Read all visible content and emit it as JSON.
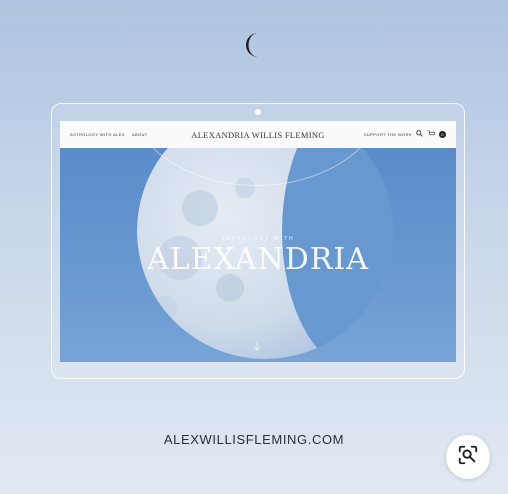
{
  "website": {
    "nav_left": [
      "ASTROLOGY WITH ALEX",
      "ABOUT"
    ],
    "site_name": "ALEXANDRIA WILLIS FLEMING",
    "nav_right_label": "SUPPORT THE WORK",
    "cart_count": "0",
    "hero_eyebrow": "ASTROLOGY WITH",
    "hero_title": "ALEXANDRIA",
    "scroll_icon": "arrow-down-icon"
  },
  "caption": "ALEXWILLISFLEMING.COM",
  "icons": {
    "brand": "crescent-moon-icon",
    "visual_search": "image-search-icon",
    "search": "search-icon",
    "cart": "cart-icon"
  },
  "colors": {
    "sky_blue": "#6898d0",
    "caption_text": "#2a2f3a"
  }
}
